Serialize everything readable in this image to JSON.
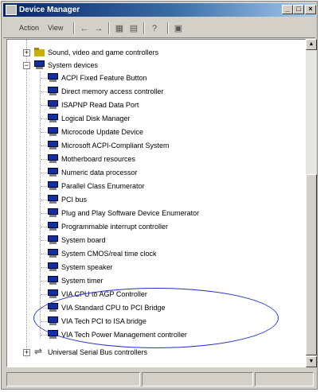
{
  "window": {
    "title": "Device Manager"
  },
  "title_buttons": {
    "minimize": "_",
    "maximize": "□",
    "close": "×"
  },
  "menu": {
    "action": "Action",
    "view": "View"
  },
  "toolbar_icons": [
    "back-arrow-icon",
    "forward-arrow-icon",
    "properties-icon",
    "details-icon",
    "help-icon",
    "scan-hardware-icon"
  ],
  "tree": {
    "sound_category": "Sound, video and game controllers",
    "system_category": "System devices",
    "system_devices": [
      "ACPI Fixed Feature Button",
      "Direct memory access controller",
      "ISAPNP Read Data Port",
      "Logical Disk Manager",
      "Microcode Update Device",
      "Microsoft ACPI-Compliant System",
      "Motherboard resources",
      "Numeric data processor",
      "Parallel Class Enumerator",
      "PCI bus",
      "Plug and Play Software Device Enumerator",
      "Programmable interrupt controller",
      "System board",
      "System CMOS/real time clock",
      "System speaker",
      "System timer",
      "VIA CPU to AGP Controller",
      "VIA Standard CPU to PCI Bridge",
      "VIA Tech PCI to ISA bridge",
      "VIA Tech Power Management controller"
    ],
    "usb_category": "Universal Serial Bus controllers"
  },
  "expanders": {
    "collapsed": "+",
    "expanded": "−"
  },
  "colors": {
    "title_start": "#0a246a",
    "title_end": "#a6caf0",
    "highlight_ellipse": "#1e2fd8",
    "device_icon": "#1030a0"
  }
}
